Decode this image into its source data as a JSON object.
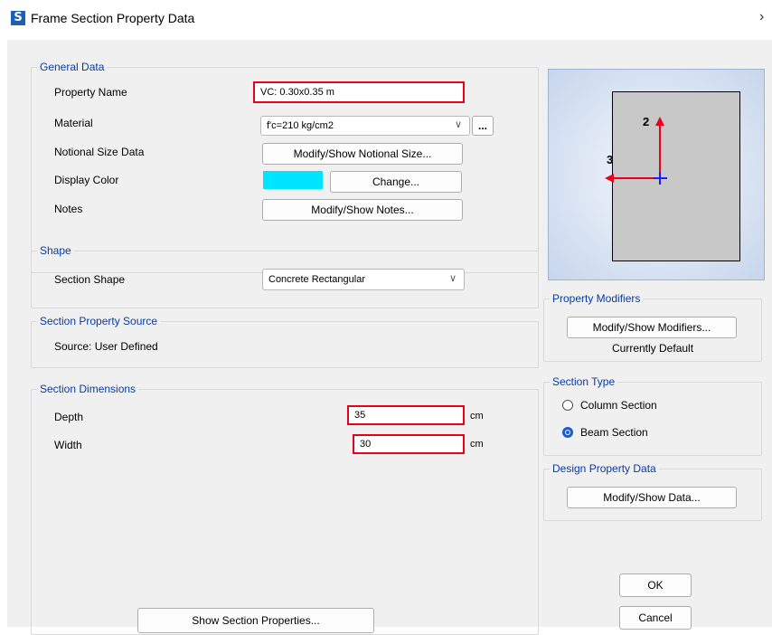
{
  "window": {
    "title": "Frame Section Property Data",
    "app_icon": "S",
    "close_icon": "›"
  },
  "general_data": {
    "title": "General Data",
    "property_name_label": "Property Name",
    "property_name_value": "VC: 0.30x0.35 m",
    "material_label": "Material",
    "material_value": "f'c=210 kg/cm2",
    "material_more_button": "...",
    "notional_label": "Notional Size Data",
    "notional_button": "Modify/Show Notional Size...",
    "display_color_label": "Display Color",
    "display_color_value": "#00e5ff",
    "change_button": "Change...",
    "notes_label": "Notes",
    "notes_button": "Modify/Show Notes..."
  },
  "shape": {
    "title": "Shape",
    "section_shape_label": "Section Shape",
    "section_shape_value": "Concrete Rectangular"
  },
  "source": {
    "title": "Section Property Source",
    "text": "Source:  User Defined"
  },
  "dimensions": {
    "title": "Section Dimensions",
    "depth_label": "Depth",
    "depth_value": "35",
    "depth_unit": "cm",
    "width_label": "Width",
    "width_value": "30",
    "width_unit": "cm"
  },
  "show_section_properties_button": "Show Section Properties...",
  "preview": {
    "axis2_label": "2",
    "axis3_label": "3"
  },
  "property_modifiers": {
    "title": "Property Modifiers",
    "button": "Modify/Show Modifiers...",
    "status": "Currently Default"
  },
  "section_type": {
    "title": "Section Type",
    "options": [
      "Column Section",
      "Beam Section"
    ],
    "selected": "Beam Section"
  },
  "design_property": {
    "title": "Design Property Data",
    "button": "Modify/Show Data..."
  },
  "ok_button": "OK",
  "cancel_button": "Cancel",
  "colors": {
    "highlight": "#e8001c",
    "group_title": "#0a3aa0",
    "axis_red": "#e8001c",
    "axis_blue": "#1a1aff"
  }
}
